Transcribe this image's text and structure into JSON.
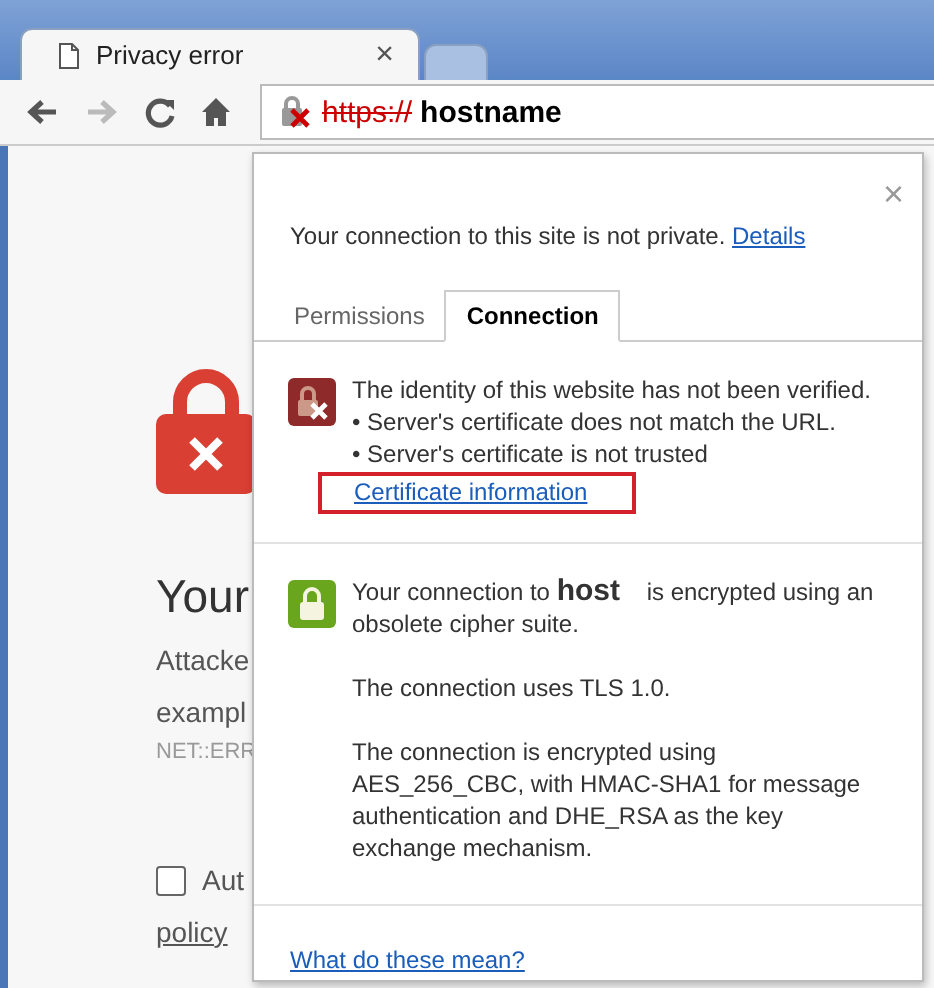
{
  "browser": {
    "tabs": [
      {
        "title": "Privacy error",
        "close": "×",
        "selected": true
      }
    ],
    "toolbar": {
      "forward_disabled": true
    },
    "address": {
      "scheme": "https://",
      "host": "hostname",
      "insecure": true
    }
  },
  "page": {
    "heading": "Your",
    "lines": [
      "Attacke",
      "exampl"
    ],
    "error_code": "NET::ERR",
    "checkbox": {
      "label": "Aut",
      "checked": false
    },
    "link": "policy"
  },
  "popup": {
    "close": "×",
    "summary": "Your connection to this site is not private.",
    "details_link": "Details",
    "tabs": [
      {
        "label": "Permissions",
        "selected": false
      },
      {
        "label": "Connection",
        "selected": true
      }
    ],
    "sections": [
      {
        "kind": "error",
        "lines": [
          "The identity of this website has not been verified.",
          "• Server's certificate does not match the URL.",
          "• Server's certificate is not trusted"
        ],
        "link": "Certificate information",
        "highlighted": true
      },
      {
        "kind": "secure",
        "paragraphs": [
          "Your connection to **host**    is encrypted using an obsolete cipher suite.",
          "The connection uses TLS 1.0.",
          "The connection is encrypted using AES_256_CBC, with HMAC-SHA1 for message authentication and DHE_RSA as the key exchange mechanism."
        ]
      }
    ],
    "help_link": "What do these mean?"
  }
}
